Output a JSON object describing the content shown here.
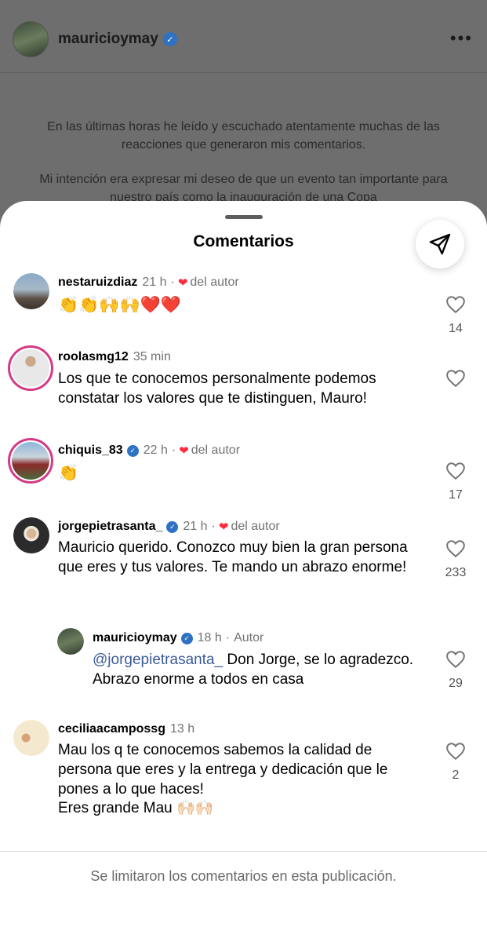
{
  "post": {
    "username": "mauricioymay",
    "more_label": "•••",
    "caption_p1": "En las últimas horas he leído y escuchado atentamente muchas de las reacciones que generaron mis comentarios.",
    "caption_p2": "Mi intención era expresar mi deseo de que un evento tan importante para nuestro país como la inauguración de una Copa"
  },
  "sheet": {
    "title": "Comentarios"
  },
  "comments": [
    {
      "username": "nestaruizdiaz",
      "time": "21 h",
      "author_like": "del autor",
      "text": "👏👏🙌🙌❤️❤️",
      "likes": "14"
    },
    {
      "username": "roolasmg12",
      "time": "35 min",
      "text": "Los que te conocemos personalmente podemos constatar los valores que te distinguen, Mauro!"
    },
    {
      "username": "chiquis_83",
      "time": "22 h",
      "author_like": "del autor",
      "text": "👏",
      "likes": "17"
    },
    {
      "username": "jorgepietrasanta_",
      "time": "21 h",
      "author_like": "del autor",
      "text": "Mauricio querido. Conozco muy bien la gran persona que eres y tus valores. Te mando un abrazo enorme!",
      "likes": "233"
    },
    {
      "username": "mauricioymay",
      "time": "18 h",
      "author_tag": "Autor",
      "mention": "@jorgepietrasanta_",
      "text": " Don Jorge, se lo agradezco. Abrazo enorme a todos en casa",
      "likes": "29"
    },
    {
      "username": "ceciliaacampossg",
      "time": "13 h",
      "text": "Mau los q te conocemos sabemos la calidad de persona que eres y  la entrega y dedicación que le pones a lo que haces!",
      "text2": "Eres grande Mau 🙌🏻🙌🏻",
      "likes": "2"
    }
  ],
  "footer": {
    "note": "Se limitaron los comentarios en esta publicación."
  },
  "colors": {
    "heart": "#ff2a3c",
    "verified": "#2f72c4",
    "story_ring": "#d43a85",
    "mention": "#3c5a9a"
  }
}
